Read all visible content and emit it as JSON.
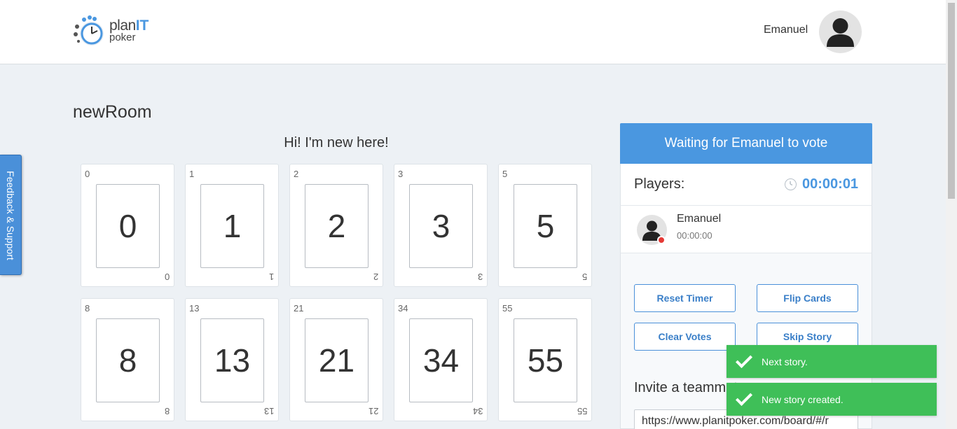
{
  "header": {
    "logo": {
      "word1": "plan",
      "word2": "IT",
      "word3": "poker"
    },
    "user_name": "Emanuel"
  },
  "feedback": {
    "label": "Feedback & Support"
  },
  "room": {
    "title": "newRoom",
    "story": "Hi! I'm new here!"
  },
  "cards": [
    {
      "value": "0"
    },
    {
      "value": "1"
    },
    {
      "value": "2"
    },
    {
      "value": "3"
    },
    {
      "value": "5"
    },
    {
      "value": "8"
    },
    {
      "value": "13"
    },
    {
      "value": "21"
    },
    {
      "value": "34"
    },
    {
      "value": "55"
    }
  ],
  "panel": {
    "status": "Waiting for Emanuel to vote",
    "players_label": "Players:",
    "timer": "00:00:01",
    "players": [
      {
        "name": "Emanuel",
        "time": "00:00:00",
        "status_color": "#e53935"
      }
    ],
    "buttons": {
      "reset_timer": "Reset Timer",
      "flip_cards": "Flip Cards",
      "clear_votes": "Clear Votes",
      "skip_story": "Skip Story"
    },
    "invite_title": "Invite a teammate",
    "invite_url": "https://www.planitpoker.com/board/#/r"
  },
  "toasts": [
    {
      "text": "Next story."
    },
    {
      "text": "New story created."
    }
  ],
  "colors": {
    "accent": "#4a97e0",
    "success": "#3fbf58",
    "background": "#edf1f5"
  }
}
